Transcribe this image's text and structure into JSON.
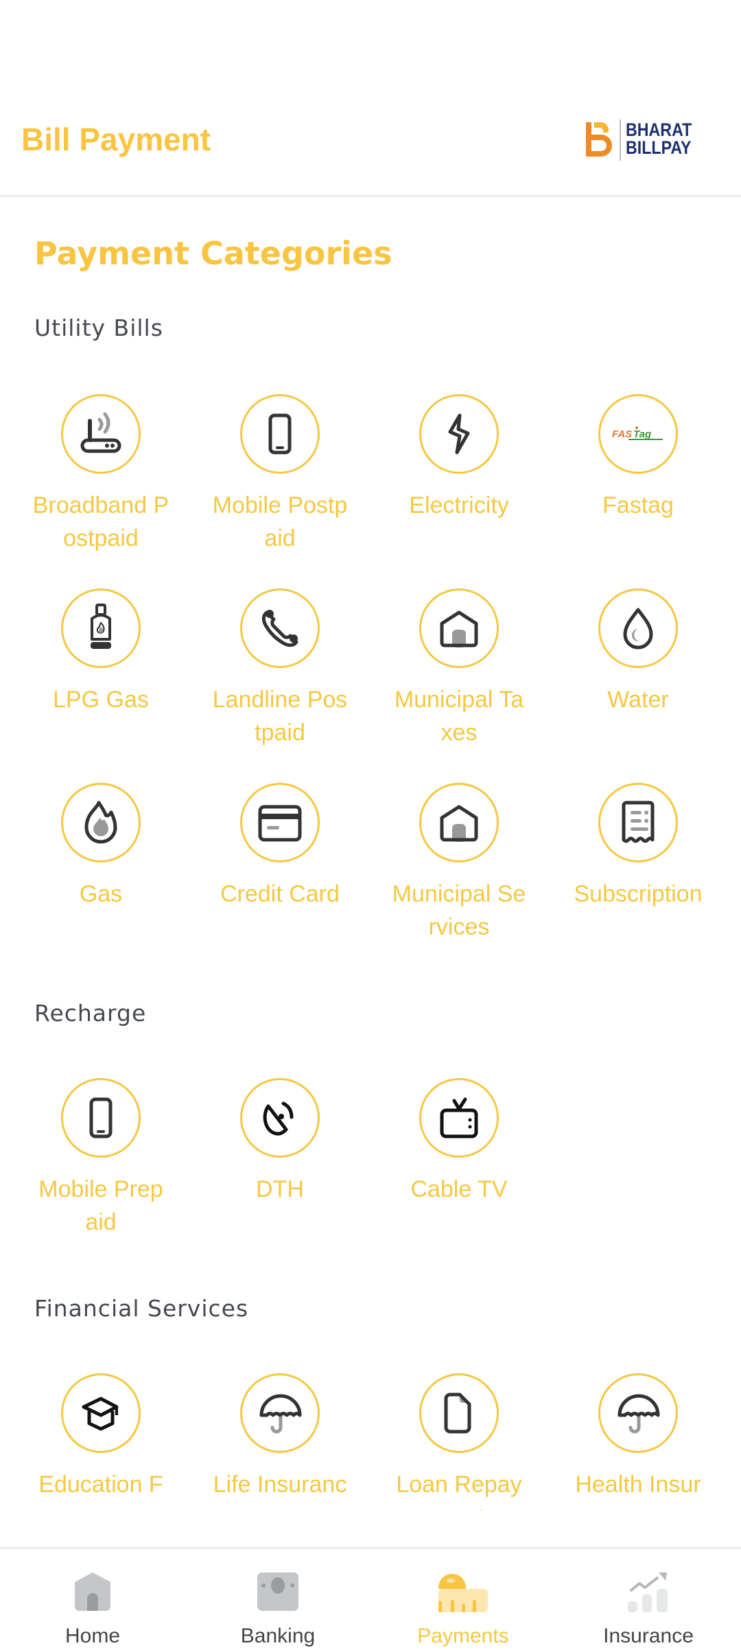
{
  "header": {
    "title": "Bill Payment",
    "logo": {
      "line1": "BHARAT",
      "line2": "BILLPAY",
      "icon": "bharat-billpay-logo"
    }
  },
  "main": {
    "section_title": "Payment Categories",
    "groups": [
      {
        "title": "Utility Bills",
        "items": [
          {
            "label": "Broadband Postpaid",
            "icon": "router-icon"
          },
          {
            "label": "Mobile Postpaid",
            "icon": "mobile-phone-icon"
          },
          {
            "label": "Electricity",
            "icon": "lightning-bolt-icon"
          },
          {
            "label": "Fastag",
            "icon": "fastag-logo-icon"
          },
          {
            "label": "LPG Gas",
            "icon": "gas-cylinder-icon"
          },
          {
            "label": "Landline Postpaid",
            "icon": "telephone-icon"
          },
          {
            "label": "Municipal Taxes",
            "icon": "house-icon"
          },
          {
            "label": "Water",
            "icon": "water-drop-icon"
          },
          {
            "label": "Gas",
            "icon": "flame-icon"
          },
          {
            "label": "Credit Card",
            "icon": "credit-card-icon"
          },
          {
            "label": "Municipal Services",
            "icon": "house-icon"
          },
          {
            "label": "Subscription",
            "icon": "receipt-icon"
          }
        ]
      },
      {
        "title": "Recharge",
        "items": [
          {
            "label": "Mobile Prepaid",
            "icon": "mobile-phone-icon"
          },
          {
            "label": "DTH",
            "icon": "satellite-dish-icon"
          },
          {
            "label": "Cable TV",
            "icon": "tv-icon"
          }
        ]
      },
      {
        "title": "Financial Services",
        "items": [
          {
            "label": "Education Fees",
            "icon": "graduation-cap-icon"
          },
          {
            "label": "Life Insurance",
            "icon": "umbrella-icon"
          },
          {
            "label": "Loan Repayment",
            "icon": "document-icon"
          },
          {
            "label": "Health Insurance",
            "icon": "umbrella-icon"
          }
        ]
      }
    ]
  },
  "bottom_nav": {
    "active": "Payments",
    "items": [
      {
        "label": "Home",
        "icon": "home-icon"
      },
      {
        "label": "Banking",
        "icon": "banknote-icon"
      },
      {
        "label": "Payments",
        "icon": "measuring-tape-icon"
      },
      {
        "label": "Insurance",
        "icon": "growth-chart-icon"
      }
    ]
  },
  "colors": {
    "accent": "#F5C842",
    "heading": "#F9C440",
    "group_title": "#454850",
    "icon_dark": "#333333",
    "icon_gray": "#999999",
    "logo_blue": "#1d2f6f",
    "logo_orange": "#F08A24"
  }
}
